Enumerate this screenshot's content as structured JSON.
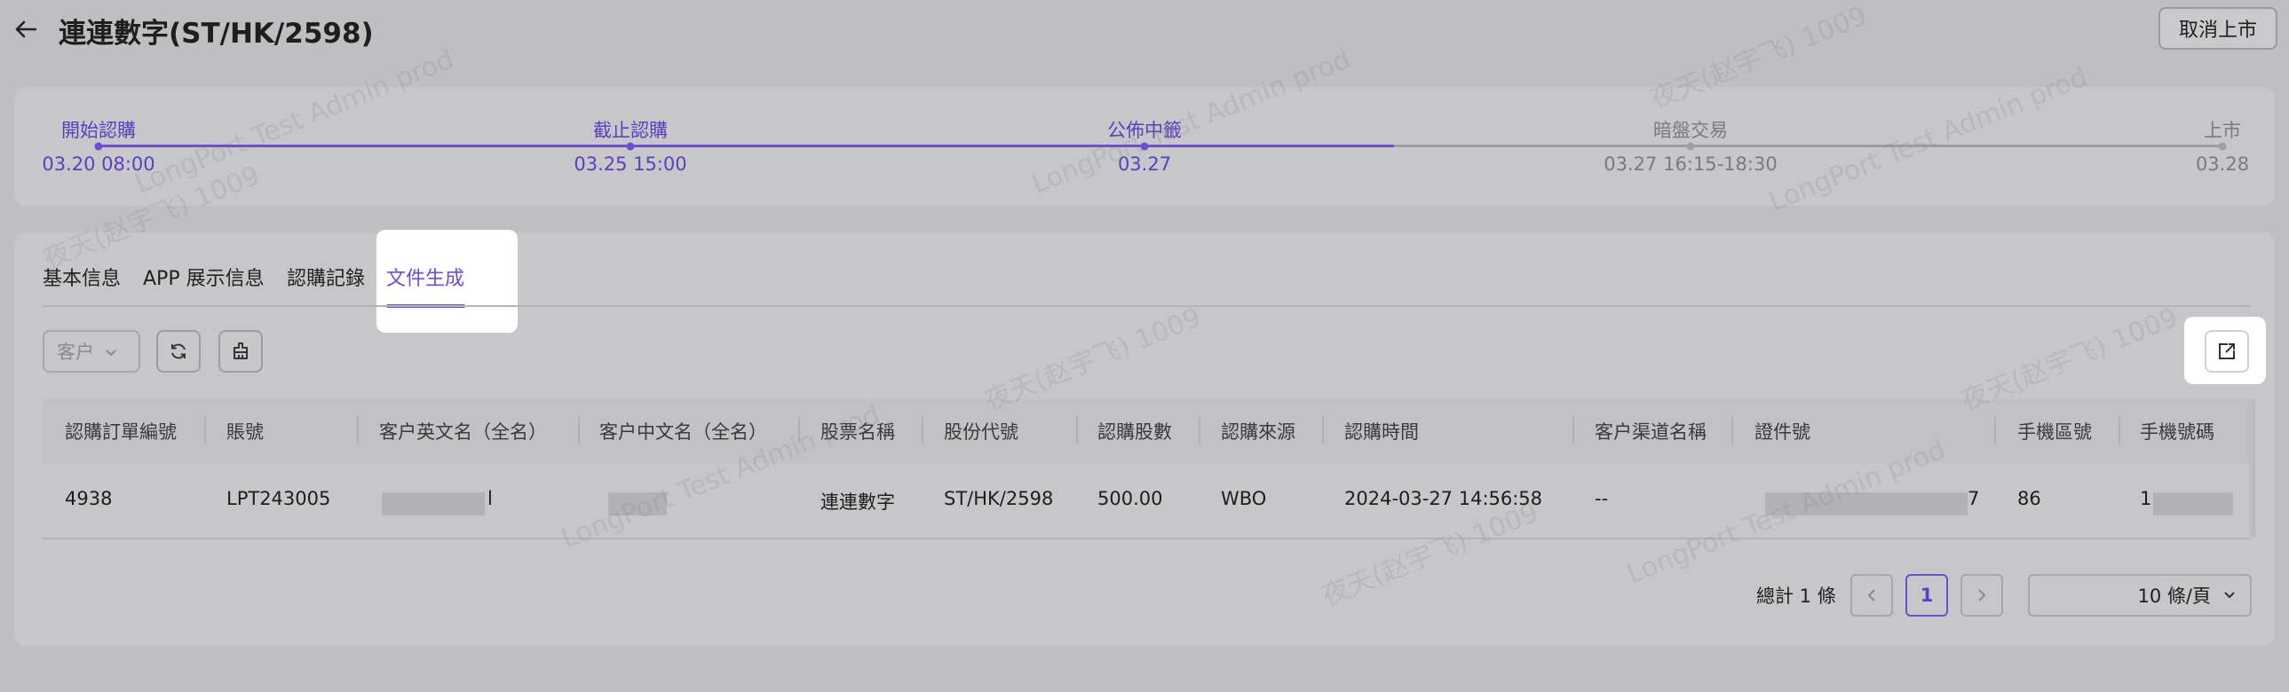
{
  "header": {
    "title": "連連數字(ST/HK/2598)",
    "cancel_button": "取消上市"
  },
  "timeline": {
    "steps": [
      {
        "label": "開始認購",
        "date": "03.20 08:00",
        "state": "done"
      },
      {
        "label": "截止認購",
        "date": "03.25 15:00",
        "state": "done"
      },
      {
        "label": "公佈中籤",
        "date": "03.27",
        "state": "done"
      },
      {
        "label": "暗盤交易",
        "date": "03.27 16:15-18:30",
        "state": "pending"
      },
      {
        "label": "上市",
        "date": "03.28",
        "state": "pending"
      }
    ],
    "accent": "#6e4bd8"
  },
  "tabs": [
    {
      "label": "基本信息"
    },
    {
      "label": "APP 展示信息"
    },
    {
      "label": "認購記錄"
    },
    {
      "label": "文件生成",
      "active": true
    }
  ],
  "filters": {
    "customer_select": "客户"
  },
  "table": {
    "columns": [
      "認購訂單編號",
      "賬號",
      "客户英文名（全名）",
      "客户中文名（全名）",
      "股票名稱",
      "股份代號",
      "認購股數",
      "認購來源",
      "認購時間",
      "客户渠道名稱",
      "證件號",
      "手機區號",
      "手機號碼"
    ],
    "rows": [
      {
        "order_no": "4938",
        "account": "LPT243005",
        "en_name": "l",
        "cn_name": "",
        "stock_name": "連連數字",
        "stock_code": "ST/HK/2598",
        "shares": "500.00",
        "source": "WBO",
        "time": "2024-03-27 14:56:58",
        "channel": "--",
        "id_no": "7",
        "area_code": "86",
        "phone": "1"
      }
    ]
  },
  "pagination": {
    "total": "總計 1 條",
    "current_page": "1",
    "page_size": "10 條/頁"
  },
  "watermark": {
    "text_1": "LongPort Test Admin prod",
    "text_2": "夜天(赵宇飞) 1009"
  }
}
